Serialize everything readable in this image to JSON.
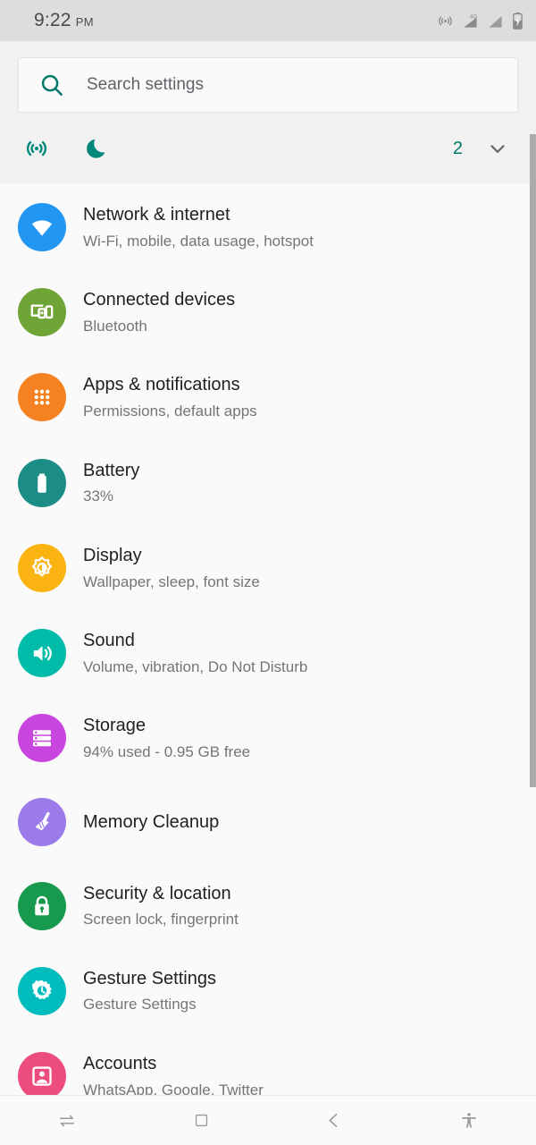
{
  "statusbar": {
    "time": "9:22",
    "ampm": "PM",
    "icons": [
      "hotspot-icon",
      "signal-4g-icon",
      "signal-icon",
      "battery-charging-icon"
    ],
    "network_label": "4G"
  },
  "search": {
    "placeholder": "Search settings",
    "value": "",
    "icon": "search-icon",
    "accent": "#00796B"
  },
  "quick_settings": {
    "icons": [
      "hotspot-icon",
      "do-not-disturb-moon-icon"
    ],
    "count": "2",
    "expand_icon": "chevron-down-icon",
    "accent": "#00796B"
  },
  "settings_list": [
    {
      "title": "Network & internet",
      "subtitle": "Wi-Fi, mobile, data usage, hotspot",
      "icon": "wifi-icon",
      "color": "#2196F3",
      "name": "network-internet"
    },
    {
      "title": "Connected devices",
      "subtitle": "Bluetooth",
      "icon": "devices-icon",
      "color": "#6FA536",
      "name": "connected-devices"
    },
    {
      "title": "Apps & notifications",
      "subtitle": "Permissions, default apps",
      "icon": "apps-grid-icon",
      "color": "#F68121",
      "name": "apps-notifications"
    },
    {
      "title": "Battery",
      "subtitle": "33%",
      "icon": "battery-icon",
      "color": "#1C8C86",
      "name": "battery"
    },
    {
      "title": "Display",
      "subtitle": "Wallpaper, sleep, font size",
      "icon": "brightness-icon",
      "color": "#FBB312",
      "name": "display"
    },
    {
      "title": "Sound",
      "subtitle": "Volume, vibration, Do Not Disturb",
      "icon": "volume-icon",
      "color": "#00BCA8",
      "name": "sound"
    },
    {
      "title": "Storage",
      "subtitle": "94% used - 0.95 GB free",
      "icon": "storage-icon",
      "color": "#C845DE",
      "name": "storage"
    },
    {
      "title": "Memory Cleanup",
      "subtitle": "",
      "icon": "broom-icon",
      "color": "#9B7BEA",
      "name": "memory-cleanup"
    },
    {
      "title": "Security & location",
      "subtitle": "Screen lock, fingerprint",
      "icon": "lock-icon",
      "color": "#189A4E",
      "name": "security-location"
    },
    {
      "title": "Gesture Settings",
      "subtitle": "Gesture Settings",
      "icon": "gear-icon",
      "color": "#00BCBC",
      "name": "gesture-settings"
    },
    {
      "title": "Accounts",
      "subtitle": "WhatsApp, Google, Twitter",
      "icon": "account-box-icon",
      "color": "#EC4C7E",
      "name": "accounts"
    }
  ],
  "navbar": {
    "buttons": [
      {
        "name": "recents-button",
        "icon": "swap-arrows-icon"
      },
      {
        "name": "home-button",
        "icon": "square-icon"
      },
      {
        "name": "back-button",
        "icon": "arrow-left-icon"
      },
      {
        "name": "accessibility-button",
        "icon": "accessibility-person-icon"
      }
    ]
  }
}
